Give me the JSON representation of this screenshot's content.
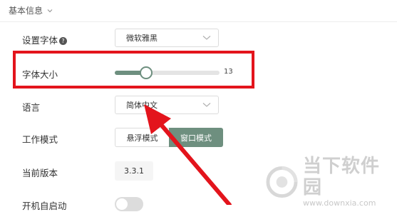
{
  "section": {
    "title": "基本信息"
  },
  "settings": {
    "font_label": "设置字体",
    "font_value": "微软雅黑",
    "font_size_label": "字体大小",
    "font_size_value": "13",
    "font_size_fraction": 0.3,
    "language_label": "语言",
    "language_value": "简体中文",
    "work_mode_label": "工作模式",
    "work_mode_options": [
      "悬浮模式",
      "窗口模式"
    ],
    "work_mode_selected": "窗口模式",
    "version_label": "当前版本",
    "version_value": "3.3.1",
    "autostart_label": "开机自启动",
    "autostart_on": false
  },
  "annotation": {
    "highlight_color": "#e3141c",
    "arrow_color": "#e3141c"
  },
  "theme": {
    "accent": "#6e8f7f"
  },
  "watermark": {
    "title": "当下软件园",
    "url": "www.downxia.com"
  }
}
